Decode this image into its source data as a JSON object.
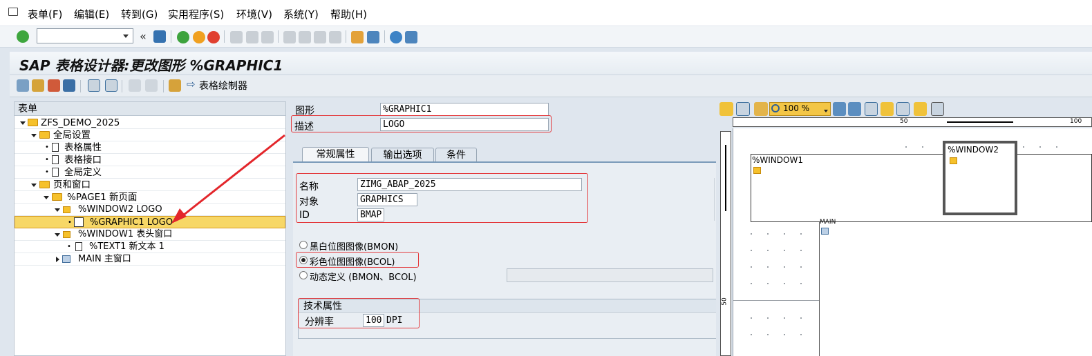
{
  "menu": [
    "表单(F)",
    "编辑(E)",
    "转到(G)",
    "实用程序(S)",
    "环境(V)",
    "系统(Y)",
    "帮助(H)"
  ],
  "title": "SAP 表格设计器:更改图形 %GRAPHIC1",
  "app_toolbar": {
    "painter_label": "表格绘制器"
  },
  "tree": {
    "header": "表单",
    "nodes": [
      {
        "label": "ZFS_DEMO_2025"
      },
      {
        "label": "全局设置"
      },
      {
        "label": "表格属性"
      },
      {
        "label": "表格接口"
      },
      {
        "label": "全局定义"
      },
      {
        "label": "页和窗口"
      },
      {
        "label": "%PAGE1 新页面"
      },
      {
        "label": "%WINDOW2 LOGO"
      },
      {
        "label": "%GRAPHIC1 LOGO"
      },
      {
        "label": "%WINDOW1 表头窗口"
      },
      {
        "label": "%TEXT1 新文本 1"
      },
      {
        "label": "MAIN 主窗口"
      }
    ]
  },
  "form": {
    "graphic_label": "图形",
    "graphic_value": "%GRAPHIC1",
    "desc_label": "描述",
    "desc_value": "LOGO"
  },
  "tabs": [
    "常规属性",
    "输出选项",
    "条件"
  ],
  "general": {
    "name_label": "名称",
    "name_value": "ZIMG_ABAP_2025",
    "object_label": "对象",
    "object_value": "GRAPHICS",
    "id_label": "ID",
    "id_value": "BMAP"
  },
  "radios": [
    {
      "label": "黑白位图图像(BMON)",
      "checked": false
    },
    {
      "label": "彩色位图图像(BCOL)",
      "checked": true
    },
    {
      "label": "动态定义 (BMON、BCOL)",
      "checked": false
    }
  ],
  "tech": {
    "header": "技术属性",
    "res_label": "分辨率",
    "res_value": "100",
    "res_unit": "DPI"
  },
  "painter": {
    "zoom": "100 %",
    "ruler_50": "50",
    "ruler_100": "100",
    "window1": "%WINDOW1",
    "window2": "%WINDOW2",
    "main": "MAIN",
    "vruler_50": "50"
  }
}
